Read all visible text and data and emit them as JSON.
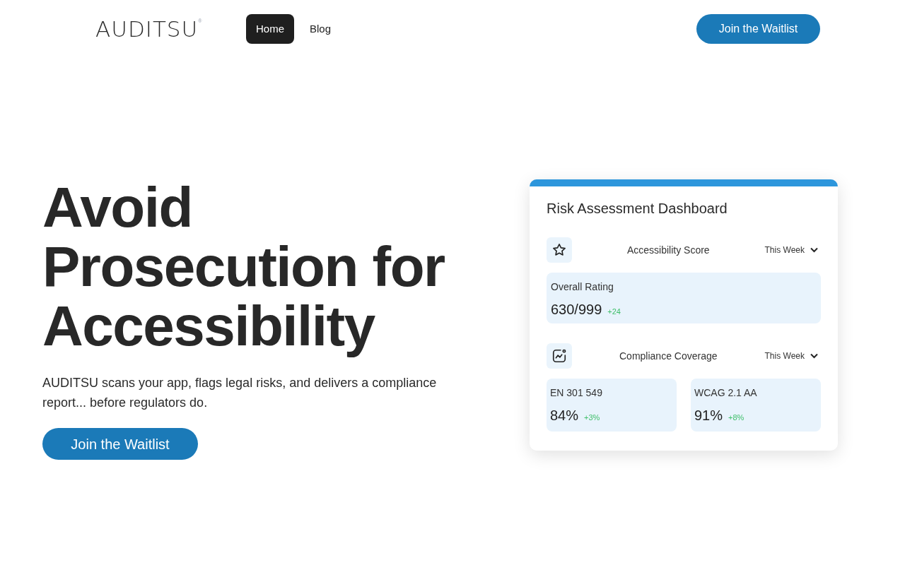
{
  "header": {
    "logo": {
      "text": "AUDITSU",
      "mark": "®"
    },
    "nav": [
      {
        "label": "Home",
        "selected": true
      },
      {
        "label": "Blog",
        "selected": false
      }
    ],
    "cta": "Join the Waitlist"
  },
  "hero": {
    "heading": [
      "Avoid",
      "Prosecution for",
      "Accessibility"
    ],
    "description": "AUDITSU scans your app, flags legal risks, and delivers a compliance report... before regulators do.",
    "cta": "Join the Waitlist"
  },
  "dashboard": {
    "title": "Risk Assessment Dashboard",
    "sections": [
      {
        "kind": "score",
        "label": "Accessibility Score",
        "period": "This Week",
        "metrics": [
          {
            "label": "Overall Rating",
            "value": "630/999",
            "change": "+24"
          }
        ]
      },
      {
        "kind": "coverage",
        "label": "Compliance Coverage",
        "period": "This Week",
        "metrics": [
          {
            "label": "EN 301 549",
            "value": "84%",
            "change": "+3%"
          },
          {
            "label": "WCAG 2.1 AA",
            "value": "91%",
            "change": "+8%"
          }
        ]
      }
    ]
  }
}
